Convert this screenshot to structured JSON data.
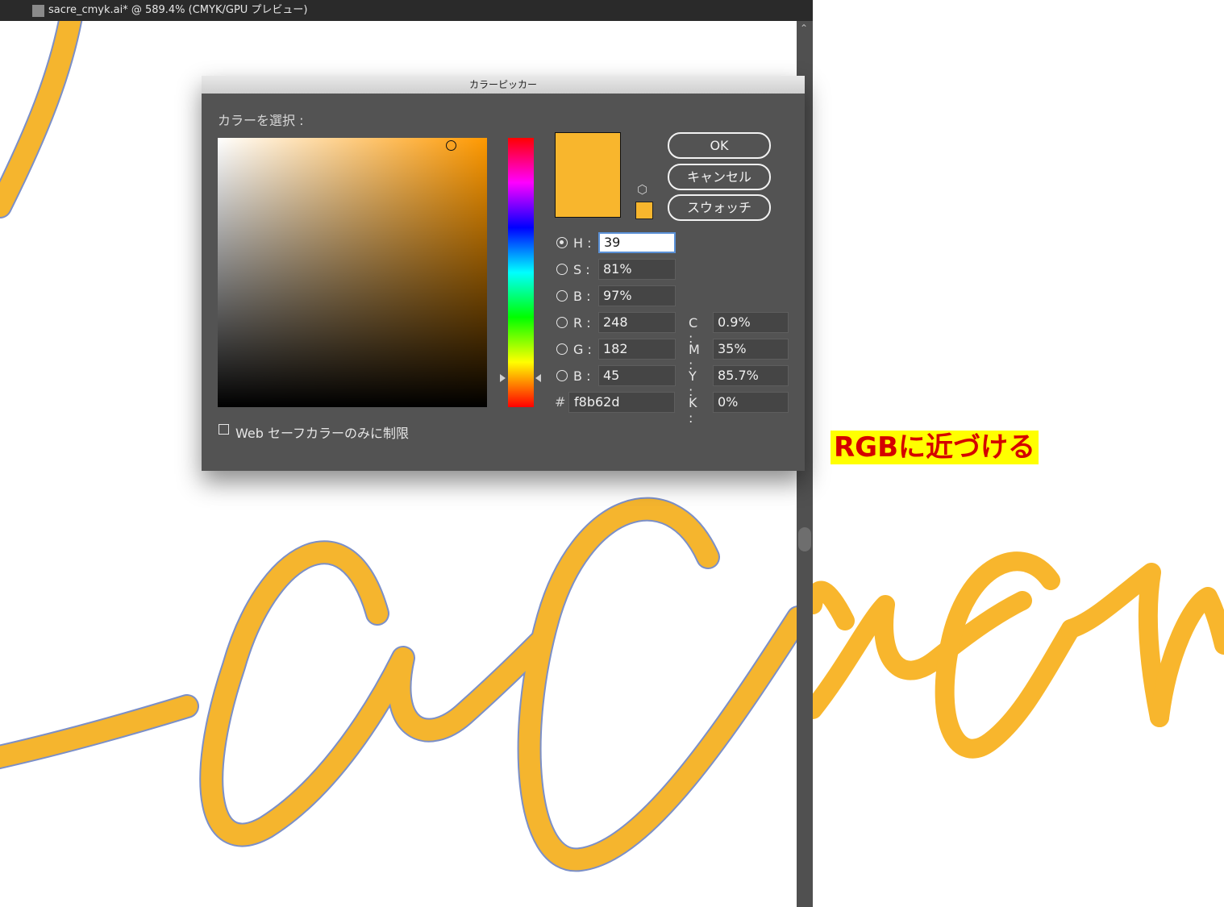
{
  "document": {
    "title": "sacre_cmyk.ai* @ 589.4% (CMYK/GPU プレビュー)"
  },
  "artwork": {
    "cmyk_fill": "#f5b52e",
    "cmyk_outline": "#7b8fc8",
    "rgb_fill": "#f8b62d"
  },
  "caption": {
    "text": "RGBに近づける",
    "bg": "#ffff00",
    "color": "#d40000"
  },
  "dialog": {
    "title": "カラーピッカー",
    "select_label": "カラーを選択 :",
    "buttons": {
      "ok": "OK",
      "cancel": "キャンセル",
      "swatches": "スウォッチ"
    },
    "current_color": "#f8b62d",
    "hue_slider_level": 0.108,
    "field_marker": {
      "saturation": 0.81,
      "brightness": 0.97
    },
    "fields": {
      "h": {
        "label": "H :",
        "value": "39",
        "selected": true
      },
      "s": {
        "label": "S :",
        "value": "81%"
      },
      "b": {
        "label": "B :",
        "value": "97%"
      },
      "r": {
        "label": "R :",
        "value": "248"
      },
      "g": {
        "label": "G :",
        "value": "182"
      },
      "b2": {
        "label": "B :",
        "value": "45"
      },
      "hex": {
        "label": "#",
        "value": "f8b62d"
      }
    },
    "cmyk": {
      "c": {
        "label": "C :",
        "value": "0.9%"
      },
      "m": {
        "label": "M :",
        "value": "35%"
      },
      "y": {
        "label": "Y :",
        "value": "85.7%"
      },
      "k": {
        "label": "K :",
        "value": "0%"
      }
    },
    "web_safe_label": "Web セーフカラーのみに制限",
    "web_safe_checked": false,
    "icons": [
      "gamut-warning-cube-icon",
      "scroll-up-chevron-icon"
    ]
  }
}
